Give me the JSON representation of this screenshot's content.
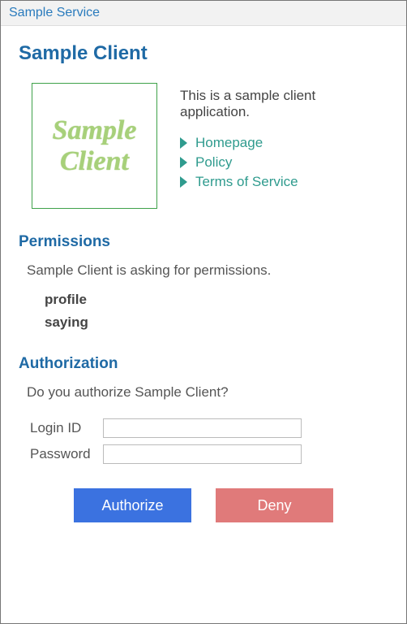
{
  "titlebar": {
    "service_name": "Sample Service"
  },
  "client": {
    "heading": "Sample Client",
    "logo_line1": "Sample",
    "logo_line2": "Client",
    "description": "This is a sample client application.",
    "links": {
      "homepage": "Homepage",
      "policy": "Policy",
      "tos": "Terms of Service"
    }
  },
  "permissions": {
    "heading": "Permissions",
    "intro": "Sample Client is asking for permissions.",
    "items": {
      "0": "profile",
      "1": "saying"
    }
  },
  "authorization": {
    "heading": "Authorization",
    "question": "Do you authorize Sample Client?",
    "login_label": "Login ID",
    "password_label": "Password",
    "authorize_btn": "Authorize",
    "deny_btn": "Deny"
  }
}
